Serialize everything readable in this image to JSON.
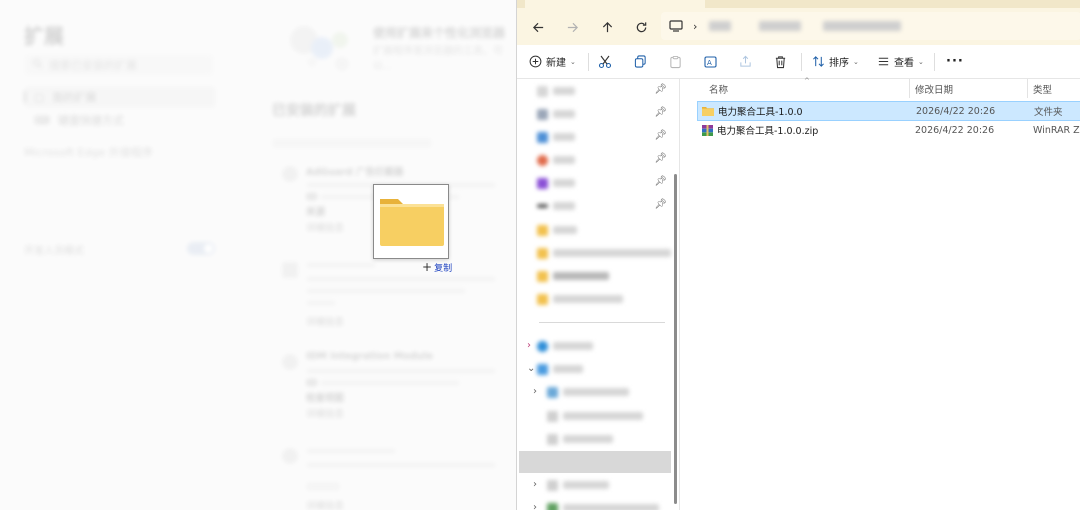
{
  "edge": {
    "title": "扩展",
    "search_placeholder": "搜索已安装的扩展",
    "nav": [
      "我的扩展",
      "键盘快捷方式"
    ],
    "store_link": "Microsoft Edge 外接程序",
    "dev_mode": "开发人员模式",
    "banner_title": "使用扩展来个性化浏览器",
    "banner_sub": "扩展程序是浏览器的工具，可以...",
    "installed": "已安装的扩展",
    "cards": [
      {
        "name": "AdGuard 广告拦截器",
        "id": "ID",
        "source": "来源",
        "detail": "详细信息"
      },
      {
        "name": "",
        "id": "",
        "source": "",
        "detail": "详细信息"
      },
      {
        "name": "IDM Integration Module",
        "id": "ID",
        "source": "检查视图",
        "detail": "详细信息"
      },
      {
        "name": "",
        "id": "",
        "source": "",
        "detail": "详细信息"
      }
    ]
  },
  "drag": {
    "caption_plus": "+",
    "caption": "复制",
    "folder_color": "#f7cf62"
  },
  "explorer": {
    "toolbar": {
      "new_label": "新建",
      "sort_label": "排序",
      "view_label": "查看",
      "more_label": "···"
    },
    "columns": {
      "name": "名称",
      "date": "修改日期",
      "type": "类型"
    },
    "files": [
      {
        "name": "电力聚合工具-1.0.0",
        "date": "2026/4/22 20:26",
        "type": "文件夹",
        "icon": "folder-icon",
        "selected": true
      },
      {
        "name": "电力聚合工具-1.0.0.zip",
        "date": "2026/4/22 20:26",
        "type": "WinRAR ZIP",
        "icon": "winrar-archive-icon",
        "selected": false
      }
    ]
  },
  "colors": {
    "selection": "#cce8ff",
    "selection_border": "#99d1ff",
    "folder": "#f7cf62",
    "address_bar": "#fbf5e2"
  }
}
